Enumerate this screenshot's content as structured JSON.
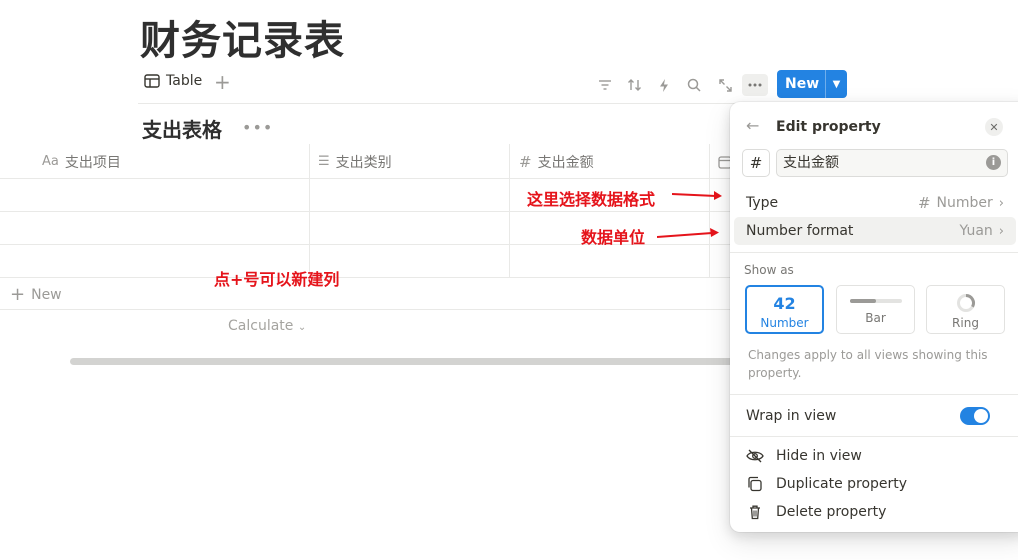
{
  "page": {
    "title": "财务记录表"
  },
  "view_bar": {
    "tab_label": "Table",
    "add_view": "+",
    "new_label": "New"
  },
  "database": {
    "title": "支出表格",
    "more": "•••",
    "columns": [
      {
        "icon": "Aa",
        "label": "支出项目"
      },
      {
        "icon": "☰",
        "label": "支出类别"
      },
      {
        "icon": "#",
        "label": "支出金额"
      }
    ],
    "new_row": "New",
    "calculate": "Calculate"
  },
  "annotations": {
    "select_format": "这里选择数据格式",
    "unit": "数据单位",
    "add_column": "点+号可以新建列"
  },
  "panel": {
    "title": "Edit property",
    "type_icon": "#",
    "property_name": "支出金额",
    "type_label": "Type",
    "type_value": "Number",
    "format_label": "Number format",
    "format_value": "Yuan",
    "show_as_label": "Show as",
    "show_as": {
      "number_sample": "42",
      "number": "Number",
      "bar": "Bar",
      "ring": "Ring",
      "selected": "Number"
    },
    "note": "Changes apply to all views showing this property.",
    "wrap_label": "Wrap in view",
    "wrap_on": true,
    "hide_label": "Hide in view",
    "duplicate_label": "Duplicate property",
    "delete_label": "Delete property"
  },
  "colors": {
    "accent": "#2383e2",
    "annotation": "#e5141b"
  }
}
